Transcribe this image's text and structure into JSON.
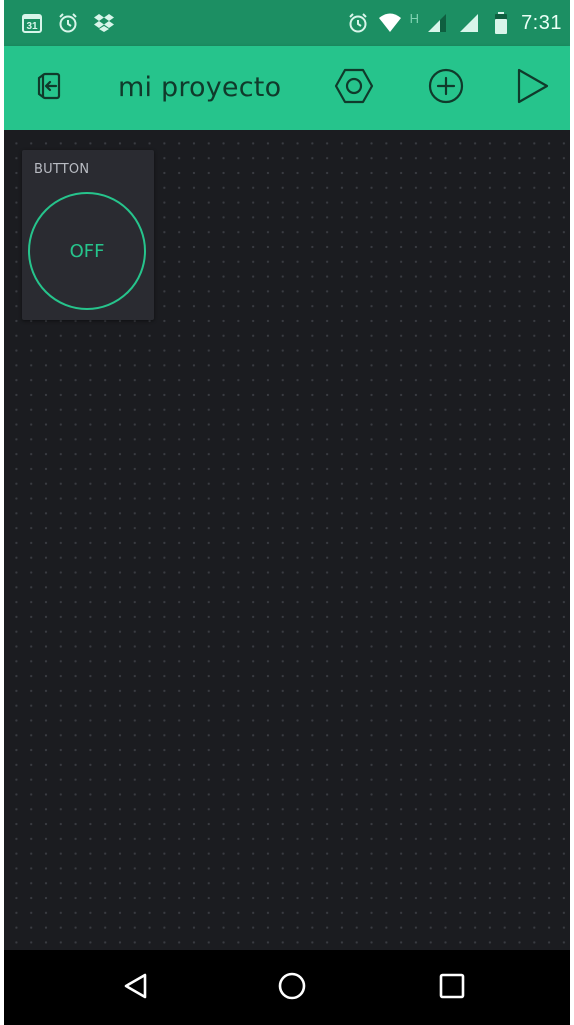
{
  "status_bar": {
    "calendar_day": "31",
    "network_type": "H",
    "time": "7:31",
    "icons": [
      "calendar-icon",
      "alarm-icon",
      "dropbox-icon",
      "alarm-icon",
      "wifi-icon",
      "signal-icon",
      "battery-icon"
    ]
  },
  "app_bar": {
    "title": "mi proyecto",
    "background": "#26c48c",
    "icons": [
      "exit-project-icon",
      "settings-hexagon-icon",
      "add-widget-icon",
      "play-icon"
    ]
  },
  "canvas": {
    "widgets": [
      {
        "type": "button",
        "label": "BUTTON",
        "state": "OFF",
        "accent": "#26c48c"
      }
    ]
  },
  "nav_bar": {
    "icons": [
      "back-icon",
      "home-icon",
      "recents-icon"
    ]
  }
}
